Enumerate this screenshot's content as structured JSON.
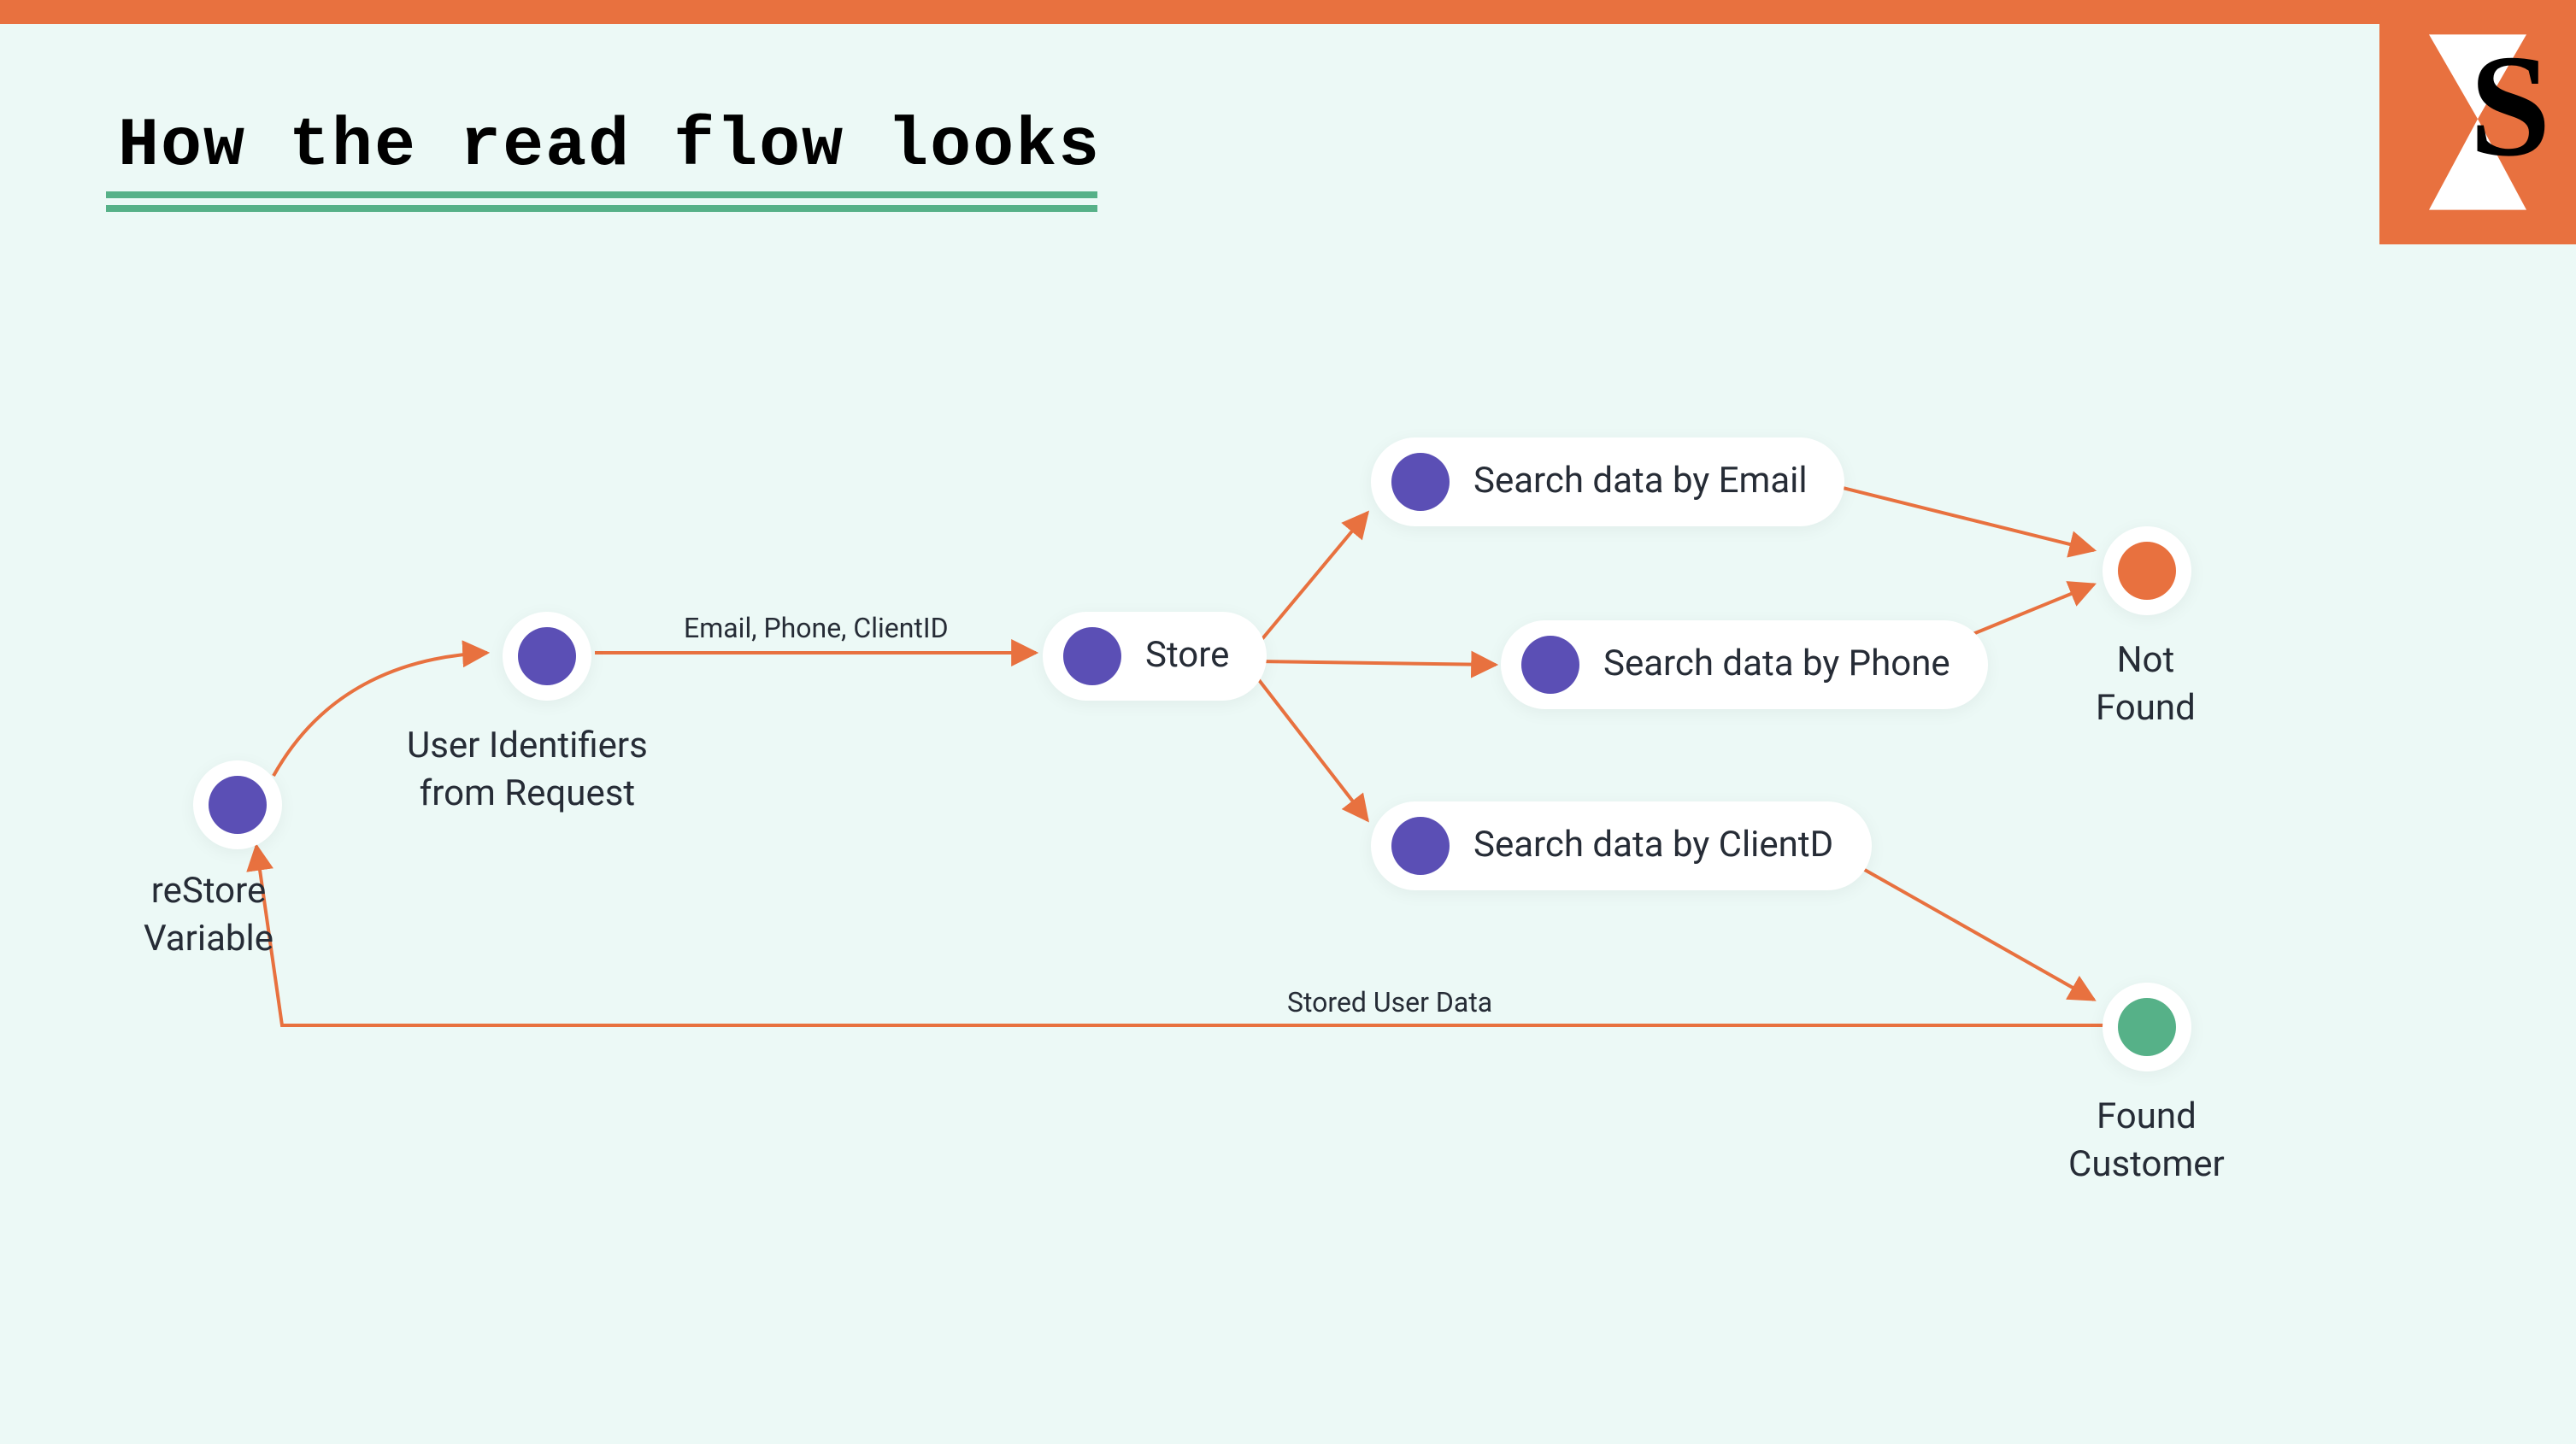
{
  "title": "How the read flow looks",
  "logo_letter": "S",
  "colors": {
    "accent_orange": "#e8713f",
    "accent_purple": "#5b4fb5",
    "accent_green": "#56b188",
    "bg": "#ecf9f6",
    "underline": "#56b188"
  },
  "nodes": {
    "restore": {
      "label": "reStore\nVariable",
      "label_lines": [
        "reStore",
        "Variable"
      ],
      "color": "purple"
    },
    "user_ids": {
      "label": "User Identifiers\nfrom Request",
      "label_lines": [
        "User Identifiers",
        "from Request"
      ],
      "color": "purple"
    },
    "store": {
      "label": "Store",
      "color": "purple"
    },
    "by_email": {
      "label": "Search data by Email",
      "color": "purple"
    },
    "by_phone": {
      "label": "Search data by Phone",
      "color": "purple"
    },
    "by_client": {
      "label": "Search data by ClientD",
      "color": "purple"
    },
    "not_found": {
      "label": "Not\nFound",
      "label_lines": [
        "Not",
        "Found"
      ],
      "color": "orange"
    },
    "found": {
      "label": "Found\nCustomer",
      "label_lines": [
        "Found",
        "Customer"
      ],
      "color": "green"
    }
  },
  "edges": {
    "ids_to_store": {
      "label": "Email, Phone, ClientID"
    },
    "found_to_restore": {
      "label": "Stored User Data"
    }
  }
}
